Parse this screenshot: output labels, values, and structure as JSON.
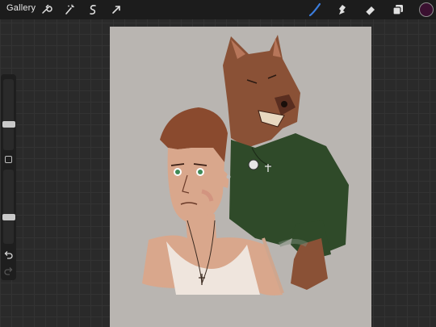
{
  "toolbar": {
    "gallery_label": "Gallery",
    "left_tools": [
      {
        "name": "wrench-icon"
      },
      {
        "name": "magic-wand-icon"
      },
      {
        "name": "selection-icon"
      },
      {
        "name": "transform-arrow-icon"
      }
    ],
    "right_tools": [
      {
        "name": "brush-icon",
        "active": true
      },
      {
        "name": "smudge-icon",
        "active": false
      },
      {
        "name": "eraser-icon",
        "active": false
      },
      {
        "name": "layers-icon",
        "active": false
      }
    ],
    "active_color": "#3a1030",
    "accent_color": "#3b7ddd"
  },
  "sidebar": {
    "brush_size_level": 0.35,
    "opacity_level": 0.35,
    "undo_icon": "undo-icon",
    "redo_icon": "redo-icon"
  },
  "canvas": {
    "background_color": "#b9b5b1"
  }
}
